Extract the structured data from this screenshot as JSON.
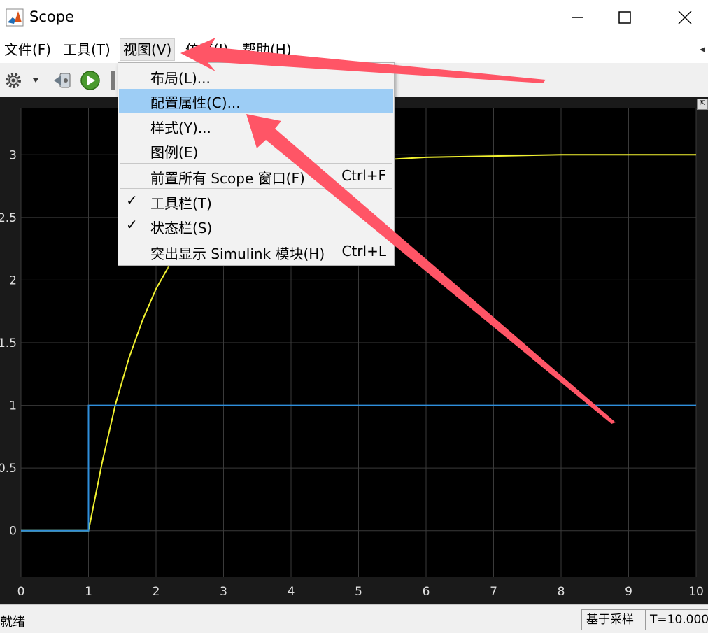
{
  "window": {
    "title": "Scope",
    "app_icon": "matlab-logo-icon"
  },
  "window_controls": {
    "minimize": "minimize-icon",
    "maximize": "maximize-icon",
    "close": "close-icon"
  },
  "menubar": {
    "items": [
      "文件(F)",
      "工具(T)",
      "视图(V)",
      "仿真(I)",
      "帮助(H)"
    ],
    "active": "视图(V)"
  },
  "toolbar": {
    "icons": [
      "gear-icon",
      "dropdown-arrow-icon",
      "step-back-icon",
      "run-icon"
    ]
  },
  "view_menu": {
    "items": [
      {
        "label": "布局(L)...",
        "shortcut": "",
        "checked": false,
        "highlighted": false
      },
      {
        "label": "配置属性(C)...",
        "shortcut": "",
        "checked": false,
        "highlighted": true
      },
      {
        "label": "样式(Y)...",
        "shortcut": "",
        "checked": false,
        "highlighted": false
      },
      {
        "label": "图例(E)",
        "shortcut": "",
        "checked": false,
        "highlighted": false
      },
      {
        "label": "前置所有 Scope 窗口(F)",
        "shortcut": "Ctrl+F",
        "checked": false,
        "highlighted": false
      },
      {
        "label": "工具栏(T)",
        "shortcut": "",
        "checked": true,
        "highlighted": false
      },
      {
        "label": "状态栏(S)",
        "shortcut": "",
        "checked": true,
        "highlighted": false
      },
      {
        "label": "突出显示 Simulink 模块(H)",
        "shortcut": "Ctrl+L",
        "checked": false,
        "highlighted": false
      }
    ]
  },
  "chart_data": {
    "type": "line",
    "xlim": [
      0,
      10
    ],
    "ylim": [
      -0.37,
      3.37
    ],
    "x_ticks": [
      "0",
      "1",
      "2",
      "3",
      "4",
      "5",
      "6",
      "7",
      "8",
      "9",
      "10"
    ],
    "y_ticks": [
      "0",
      "0.5",
      "1",
      "1.5",
      "2",
      "2.5",
      "3"
    ],
    "grid": true,
    "background": "#000000",
    "series": [
      {
        "color": "#f2f230",
        "points": [
          [
            0,
            0
          ],
          [
            1,
            0
          ],
          [
            1.2,
            0.54
          ],
          [
            1.4,
            1.01
          ],
          [
            1.6,
            1.38
          ],
          [
            1.8,
            1.68
          ],
          [
            2,
            1.93
          ],
          [
            2.2,
            2.12
          ],
          [
            2.5,
            2.35
          ],
          [
            3,
            2.59
          ],
          [
            3.5,
            2.75
          ],
          [
            4,
            2.85
          ],
          [
            4.5,
            2.91
          ],
          [
            5,
            2.95
          ],
          [
            6,
            2.98
          ],
          [
            7,
            2.99
          ],
          [
            8,
            3.0
          ],
          [
            10,
            3.0
          ]
        ]
      },
      {
        "color": "#2f8fdc",
        "points": [
          [
            0,
            0
          ],
          [
            1,
            0
          ],
          [
            1,
            1
          ],
          [
            10,
            1
          ]
        ]
      }
    ]
  },
  "statusbar": {
    "left": "就绪",
    "mode": "基于采样",
    "time": "T=10.000"
  },
  "colors": {
    "arrow": "#ff5566",
    "menu_highlight": "#9dcdf5"
  }
}
